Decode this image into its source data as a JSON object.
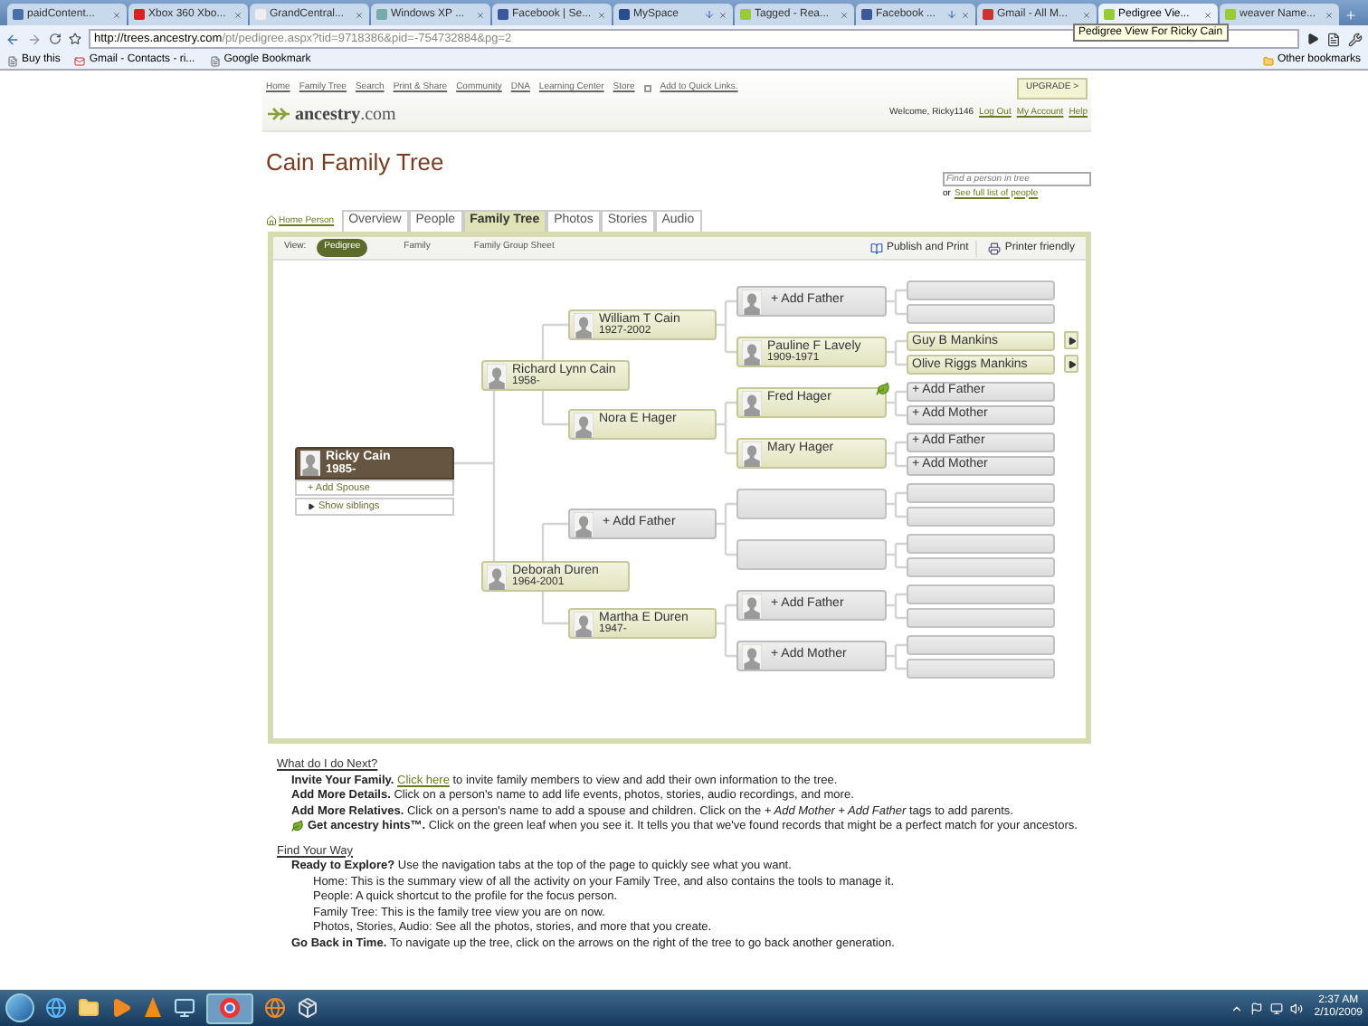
{
  "browser": {
    "tabs": [
      {
        "title": "paidContent...",
        "selected": false,
        "arrow": false
      },
      {
        "title": "Xbox 360 Xbo...",
        "selected": false,
        "arrow": false
      },
      {
        "title": "GrandCentral...",
        "selected": false,
        "arrow": false
      },
      {
        "title": "Windows XP ...",
        "selected": false,
        "arrow": false
      },
      {
        "title": "Facebook | Se...",
        "selected": false,
        "arrow": false
      },
      {
        "title": "MySpace",
        "selected": false,
        "arrow": true
      },
      {
        "title": "Tagged - Rea...",
        "selected": false,
        "arrow": false
      },
      {
        "title": "Facebook ...",
        "selected": false,
        "arrow": true
      },
      {
        "title": "Gmail - All M...",
        "selected": false,
        "arrow": false
      },
      {
        "title": "Pedigree Vie...",
        "selected": true,
        "arrow": false
      },
      {
        "title": "weaver Name...",
        "selected": false,
        "arrow": false
      }
    ],
    "tooltip": "Pedigree View For Ricky Cain",
    "url_host": "http://trees.ancestry.com",
    "url_path": "/pt/pedigree.aspx?tid=9718386&pid=-754732884&pg=2",
    "bookmarks": [
      "Buy this",
      "Gmail - Contacts - ri...",
      "Google Bookmark"
    ],
    "other_bookmarks": "Other bookmarks"
  },
  "site": {
    "nav": [
      "Home",
      "Family Tree",
      "Search",
      "Print & Share",
      "Community",
      "DNA",
      "Learning Center",
      "Store"
    ],
    "quick_links": "Add to Quick Links.",
    "upgrade": "UPGRADE >",
    "logo_name": "ancestry",
    "logo_domain": ".com",
    "welcome": "Welcome, Ricky1146",
    "account_links": [
      "Log Out",
      "My Account",
      "Help"
    ]
  },
  "title": "Cain Family Tree",
  "search": {
    "placeholder": "Find a person in tree",
    "or": "or",
    "link": "See full list of people"
  },
  "home_person": "Home Person",
  "tabs": [
    {
      "label": "Overview",
      "selected": false
    },
    {
      "label": "People",
      "selected": false
    },
    {
      "label": "Family Tree",
      "selected": true
    },
    {
      "label": "Photos",
      "selected": false
    },
    {
      "label": "Stories",
      "selected": false
    },
    {
      "label": "Audio",
      "selected": false
    }
  ],
  "view": {
    "label": "View:",
    "options": [
      {
        "label": "Pedigree",
        "selected": true
      },
      {
        "label": "Family",
        "selected": false
      },
      {
        "label": "Family Group Sheet",
        "selected": false
      }
    ],
    "publish": "Publish and Print",
    "print": "Printer friendly"
  },
  "tree": {
    "focus": {
      "name": "Ricky Cain",
      "dates": "1985-",
      "add_spouse": "+ Add Spouse",
      "show_siblings": "Show siblings",
      "parents": [
        {
          "kind": "person",
          "name": "Richard Lynn Cain",
          "dates": "1958-",
          "parents": [
            {
              "kind": "person",
              "name": "William T Cain",
              "dates": "1927-2002",
              "parents": [
                {
                  "kind": "add",
                  "name": "+ Add Father",
                  "parents": [
                    {
                      "kind": "empty"
                    },
                    {
                      "kind": "empty"
                    }
                  ]
                },
                {
                  "kind": "person",
                  "name": "Pauline F Lavely",
                  "dates": "1909-1971",
                  "parents": [
                    {
                      "kind": "person",
                      "name": "Guy B Mankins",
                      "more": true
                    },
                    {
                      "kind": "person",
                      "name": "Olive Riggs Mankins",
                      "more": true
                    }
                  ]
                }
              ]
            },
            {
              "kind": "person",
              "name": "Nora E Hager",
              "parents": [
                {
                  "kind": "person",
                  "name": "Fred Hager",
                  "hint": true,
                  "parents": [
                    {
                      "kind": "add",
                      "name": "+ Add Father"
                    },
                    {
                      "kind": "add",
                      "name": "+ Add Mother"
                    }
                  ]
                },
                {
                  "kind": "person",
                  "name": "Mary Hager",
                  "parents": [
                    {
                      "kind": "add",
                      "name": "+ Add Father"
                    },
                    {
                      "kind": "add",
                      "name": "+ Add Mother"
                    }
                  ]
                }
              ]
            }
          ]
        },
        {
          "kind": "person",
          "name": "Deborah Duren",
          "dates": "1964-2001",
          "parents": [
            {
              "kind": "add",
              "name": "+ Add Father",
              "parents": [
                {
                  "kind": "empty",
                  "parents": [
                    {
                      "kind": "empty"
                    },
                    {
                      "kind": "empty"
                    }
                  ]
                },
                {
                  "kind": "empty",
                  "parents": [
                    {
                      "kind": "empty"
                    },
                    {
                      "kind": "empty"
                    }
                  ]
                }
              ]
            },
            {
              "kind": "person",
              "name": "Martha E Duren",
              "dates": "1947-",
              "parents": [
                {
                  "kind": "add",
                  "name": "+ Add Father",
                  "parents": [
                    {
                      "kind": "empty"
                    },
                    {
                      "kind": "empty"
                    }
                  ]
                },
                {
                  "kind": "add",
                  "name": "+ Add Mother",
                  "parents": [
                    {
                      "kind": "empty"
                    },
                    {
                      "kind": "empty"
                    }
                  ]
                }
              ]
            }
          ]
        }
      ]
    }
  },
  "help": [
    {
      "heading": "What do I do Next?",
      "items": [
        {
          "kind": "lead",
          "lead": "Invite Your Family.",
          "link": "Click here",
          "text": "to invite family members to view and add their own information to the tree."
        },
        {
          "kind": "lead",
          "lead": "Add More Details.",
          "text": "Click on a person's name to add life events, photos, stories, audio recordings, and more."
        },
        {
          "kind": "lead",
          "lead": "Add More Relatives.",
          "text": "Click on a person's name to add a spouse and children. Click on the *+ Add Mother + Add Father* tags to add parents."
        },
        {
          "kind": "hint",
          "lead": "Get ancestry hints™.",
          "text": "Click on the green leaf when you see it. It tells you that we've found records that might be a perfect match for your ancestors."
        }
      ]
    },
    {
      "heading": "Find Your Way",
      "items": [
        {
          "kind": "lead",
          "lead": "Ready to Explore?",
          "text": "Use the navigation tabs at the top of the page to quickly see what you want."
        },
        {
          "kind": "sub",
          "text": "Home: This is the summary view of all the activity on your Family Tree, and also contains the tools to manage it."
        },
        {
          "kind": "sub",
          "text": "People: A quick shortcut to the profile for the focus person."
        },
        {
          "kind": "sub",
          "text": "Family Tree: This is the family tree view you are on now."
        },
        {
          "kind": "sub",
          "text": "Photos, Stories, Audio: See all the photos, stories, and more that you create."
        },
        {
          "kind": "lead",
          "lead": "Go Back in Time.",
          "text": "To navigate up the tree, click on the arrows on the right of the tree to go back another generation."
        }
      ]
    }
  ],
  "taskbar": {
    "time": "2:37 AM",
    "date": "2/10/2009"
  }
}
